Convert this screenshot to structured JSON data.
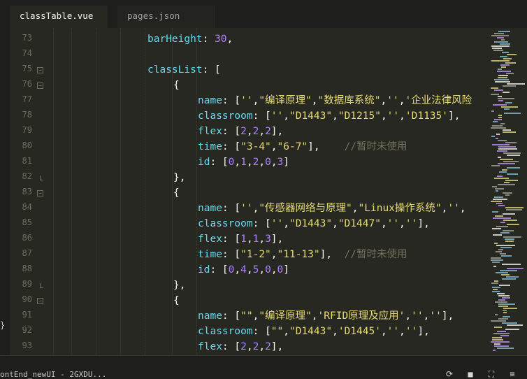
{
  "tabs": [
    {
      "label": "classTable.vue",
      "active": true
    },
    {
      "label": "pages.json",
      "active": false
    }
  ],
  "left_strip_glyph": "}",
  "editor": {
    "lines": [
      {
        "n": "73",
        "t": [
          [
            "k",
            "barHeight"
          ],
          [
            "p",
            ": "
          ],
          [
            "n",
            "30"
          ],
          [
            "p",
            ","
          ]
        ],
        "fold": ""
      },
      {
        "n": "74",
        "t": [],
        "fold": ""
      },
      {
        "n": "75",
        "t": [
          [
            "k",
            "classList"
          ],
          [
            "p",
            ": ["
          ]
        ],
        "fold": "open"
      },
      {
        "n": "76",
        "t": [
          [
            "p",
            "{"
          ]
        ],
        "fold": "open"
      },
      {
        "n": "77",
        "t": [
          [
            "k",
            "name"
          ],
          [
            "p",
            ": ["
          ],
          [
            "s",
            "''"
          ],
          [
            "p",
            ","
          ],
          [
            "s",
            "\"编译原理\""
          ],
          [
            "p",
            ","
          ],
          [
            "s",
            "\"数据库系统\""
          ],
          [
            "p",
            ","
          ],
          [
            "s",
            "''"
          ],
          [
            "p",
            ","
          ],
          [
            "s",
            "'企业法律风险"
          ]
        ],
        "fold": ""
      },
      {
        "n": "78",
        "t": [
          [
            "k",
            "classroom"
          ],
          [
            "p",
            ": ["
          ],
          [
            "s",
            "''"
          ],
          [
            "p",
            ","
          ],
          [
            "s",
            "\"D1443\""
          ],
          [
            "p",
            ","
          ],
          [
            "s",
            "\"D1215\""
          ],
          [
            "p",
            ","
          ],
          [
            "s",
            "''"
          ],
          [
            "p",
            ","
          ],
          [
            "s",
            "'D1135'"
          ],
          [
            "p",
            "],"
          ]
        ],
        "fold": ""
      },
      {
        "n": "79",
        "t": [
          [
            "k",
            "flex"
          ],
          [
            "p",
            ": ["
          ],
          [
            "n",
            "2"
          ],
          [
            "p",
            ","
          ],
          [
            "n",
            "2"
          ],
          [
            "p",
            ","
          ],
          [
            "n",
            "2"
          ],
          [
            "p",
            "],"
          ]
        ],
        "fold": ""
      },
      {
        "n": "80",
        "t": [
          [
            "k",
            "time"
          ],
          [
            "p",
            ": ["
          ],
          [
            "s",
            "\"3-4\""
          ],
          [
            "p",
            ","
          ],
          [
            "s",
            "\"6-7\""
          ],
          [
            "p",
            "],    "
          ],
          [
            "c",
            "//暂时未使用"
          ]
        ],
        "fold": ""
      },
      {
        "n": "81",
        "t": [
          [
            "k",
            "id"
          ],
          [
            "p",
            ": ["
          ],
          [
            "n",
            "0"
          ],
          [
            "p",
            ","
          ],
          [
            "n",
            "1"
          ],
          [
            "p",
            ","
          ],
          [
            "n",
            "2"
          ],
          [
            "p",
            ","
          ],
          [
            "n",
            "0"
          ],
          [
            "p",
            ","
          ],
          [
            "n",
            "3"
          ],
          [
            "p",
            "]"
          ]
        ],
        "fold": ""
      },
      {
        "n": "82",
        "t": [
          [
            "p",
            "},"
          ]
        ],
        "fold": "end"
      },
      {
        "n": "83",
        "t": [
          [
            "p",
            "{"
          ]
        ],
        "fold": "open"
      },
      {
        "n": "84",
        "t": [
          [
            "k",
            "name"
          ],
          [
            "p",
            ": ["
          ],
          [
            "s",
            "''"
          ],
          [
            "p",
            ","
          ],
          [
            "s",
            "\"传感器网络与原理\""
          ],
          [
            "p",
            ","
          ],
          [
            "s",
            "\"Linux操作系统\""
          ],
          [
            "p",
            ","
          ],
          [
            "s",
            "''"
          ],
          [
            "p",
            ","
          ]
        ],
        "fold": ""
      },
      {
        "n": "85",
        "t": [
          [
            "k",
            "classroom"
          ],
          [
            "p",
            ": ["
          ],
          [
            "s",
            "''"
          ],
          [
            "p",
            ","
          ],
          [
            "s",
            "\"D1443\""
          ],
          [
            "p",
            ","
          ],
          [
            "s",
            "\"D1447\""
          ],
          [
            "p",
            ","
          ],
          [
            "s",
            "''"
          ],
          [
            "p",
            ","
          ],
          [
            "s",
            "''"
          ],
          [
            "p",
            "],"
          ]
        ],
        "fold": ""
      },
      {
        "n": "86",
        "t": [
          [
            "k",
            "flex"
          ],
          [
            "p",
            ": ["
          ],
          [
            "n",
            "1"
          ],
          [
            "p",
            ","
          ],
          [
            "n",
            "1"
          ],
          [
            "p",
            ","
          ],
          [
            "n",
            "3"
          ],
          [
            "p",
            "],"
          ]
        ],
        "fold": ""
      },
      {
        "n": "87",
        "t": [
          [
            "k",
            "time"
          ],
          [
            "p",
            ": ["
          ],
          [
            "s",
            "\"1-2\""
          ],
          [
            "p",
            ","
          ],
          [
            "s",
            "\"11-13\""
          ],
          [
            "p",
            "],  "
          ],
          [
            "c",
            "//暂时未使用"
          ]
        ],
        "fold": ""
      },
      {
        "n": "88",
        "t": [
          [
            "k",
            "id"
          ],
          [
            "p",
            ": ["
          ],
          [
            "n",
            "0"
          ],
          [
            "p",
            ","
          ],
          [
            "n",
            "4"
          ],
          [
            "p",
            ","
          ],
          [
            "n",
            "5"
          ],
          [
            "p",
            ","
          ],
          [
            "n",
            "0"
          ],
          [
            "p",
            ","
          ],
          [
            "n",
            "0"
          ],
          [
            "p",
            "]"
          ]
        ],
        "fold": ""
      },
      {
        "n": "89",
        "t": [
          [
            "p",
            "},"
          ]
        ],
        "fold": "end"
      },
      {
        "n": "90",
        "t": [
          [
            "p",
            "{"
          ]
        ],
        "fold": "open"
      },
      {
        "n": "91",
        "t": [
          [
            "k",
            "name"
          ],
          [
            "p",
            ": ["
          ],
          [
            "s",
            "\"\""
          ],
          [
            "p",
            ","
          ],
          [
            "s",
            "\"编译原理\""
          ],
          [
            "p",
            ","
          ],
          [
            "s",
            "'RFID原理及应用'"
          ],
          [
            "p",
            ","
          ],
          [
            "s",
            "''"
          ],
          [
            "p",
            ","
          ],
          [
            "s",
            "''"
          ],
          [
            "p",
            "],"
          ]
        ],
        "fold": ""
      },
      {
        "n": "92",
        "t": [
          [
            "k",
            "classroom"
          ],
          [
            "p",
            ": ["
          ],
          [
            "s",
            "\"\""
          ],
          [
            "p",
            ","
          ],
          [
            "s",
            "\"D1443\""
          ],
          [
            "p",
            ","
          ],
          [
            "s",
            "'D1445'"
          ],
          [
            "p",
            ","
          ],
          [
            "s",
            "''"
          ],
          [
            "p",
            ","
          ],
          [
            "s",
            "''"
          ],
          [
            "p",
            "],"
          ]
        ],
        "fold": ""
      },
      {
        "n": "93",
        "t": [
          [
            "k",
            "flex"
          ],
          [
            "p",
            ": ["
          ],
          [
            "n",
            "2"
          ],
          [
            "p",
            ","
          ],
          [
            "n",
            "2"
          ],
          [
            "p",
            ","
          ],
          [
            "n",
            "2"
          ],
          [
            "p",
            "],"
          ]
        ],
        "fold": ""
      }
    ],
    "indents": [
      8,
      8,
      8,
      10,
      12,
      12,
      12,
      12,
      12,
      10,
      10,
      12,
      12,
      12,
      12,
      12,
      10,
      10,
      12,
      12,
      12
    ]
  },
  "statusbar": {
    "text": "ontEnd_newUI - 2GXDU...",
    "icons": [
      "refresh-icon",
      "stop-icon",
      "crop-icon",
      "menu-icon"
    ],
    "icon_glyphs": [
      "⟳",
      "■",
      "⛶",
      "≡"
    ]
  }
}
